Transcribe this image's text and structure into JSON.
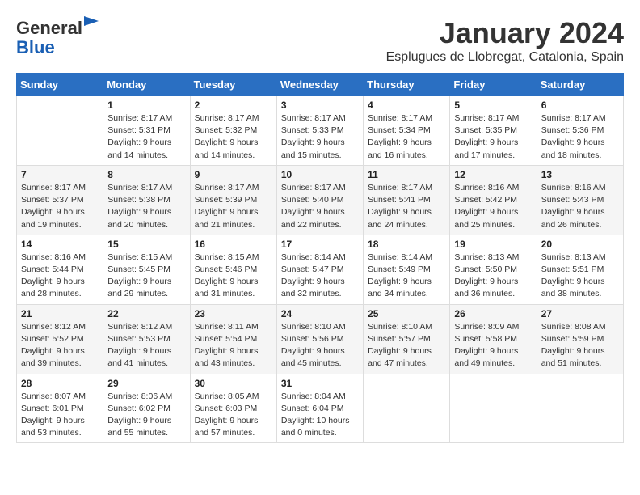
{
  "logo": {
    "general": "General",
    "blue": "Blue"
  },
  "title": "January 2024",
  "subtitle": "Esplugues de Llobregat, Catalonia, Spain",
  "weekdays": [
    "Sunday",
    "Monday",
    "Tuesday",
    "Wednesday",
    "Thursday",
    "Friday",
    "Saturday"
  ],
  "weeks": [
    [
      {
        "day": "",
        "sunrise": "",
        "sunset": "",
        "daylight": ""
      },
      {
        "day": "1",
        "sunrise": "Sunrise: 8:17 AM",
        "sunset": "Sunset: 5:31 PM",
        "daylight": "Daylight: 9 hours and 14 minutes."
      },
      {
        "day": "2",
        "sunrise": "Sunrise: 8:17 AM",
        "sunset": "Sunset: 5:32 PM",
        "daylight": "Daylight: 9 hours and 14 minutes."
      },
      {
        "day": "3",
        "sunrise": "Sunrise: 8:17 AM",
        "sunset": "Sunset: 5:33 PM",
        "daylight": "Daylight: 9 hours and 15 minutes."
      },
      {
        "day": "4",
        "sunrise": "Sunrise: 8:17 AM",
        "sunset": "Sunset: 5:34 PM",
        "daylight": "Daylight: 9 hours and 16 minutes."
      },
      {
        "day": "5",
        "sunrise": "Sunrise: 8:17 AM",
        "sunset": "Sunset: 5:35 PM",
        "daylight": "Daylight: 9 hours and 17 minutes."
      },
      {
        "day": "6",
        "sunrise": "Sunrise: 8:17 AM",
        "sunset": "Sunset: 5:36 PM",
        "daylight": "Daylight: 9 hours and 18 minutes."
      }
    ],
    [
      {
        "day": "7",
        "sunrise": "Sunrise: 8:17 AM",
        "sunset": "Sunset: 5:37 PM",
        "daylight": "Daylight: 9 hours and 19 minutes."
      },
      {
        "day": "8",
        "sunrise": "Sunrise: 8:17 AM",
        "sunset": "Sunset: 5:38 PM",
        "daylight": "Daylight: 9 hours and 20 minutes."
      },
      {
        "day": "9",
        "sunrise": "Sunrise: 8:17 AM",
        "sunset": "Sunset: 5:39 PM",
        "daylight": "Daylight: 9 hours and 21 minutes."
      },
      {
        "day": "10",
        "sunrise": "Sunrise: 8:17 AM",
        "sunset": "Sunset: 5:40 PM",
        "daylight": "Daylight: 9 hours and 22 minutes."
      },
      {
        "day": "11",
        "sunrise": "Sunrise: 8:17 AM",
        "sunset": "Sunset: 5:41 PM",
        "daylight": "Daylight: 9 hours and 24 minutes."
      },
      {
        "day": "12",
        "sunrise": "Sunrise: 8:16 AM",
        "sunset": "Sunset: 5:42 PM",
        "daylight": "Daylight: 9 hours and 25 minutes."
      },
      {
        "day": "13",
        "sunrise": "Sunrise: 8:16 AM",
        "sunset": "Sunset: 5:43 PM",
        "daylight": "Daylight: 9 hours and 26 minutes."
      }
    ],
    [
      {
        "day": "14",
        "sunrise": "Sunrise: 8:16 AM",
        "sunset": "Sunset: 5:44 PM",
        "daylight": "Daylight: 9 hours and 28 minutes."
      },
      {
        "day": "15",
        "sunrise": "Sunrise: 8:15 AM",
        "sunset": "Sunset: 5:45 PM",
        "daylight": "Daylight: 9 hours and 29 minutes."
      },
      {
        "day": "16",
        "sunrise": "Sunrise: 8:15 AM",
        "sunset": "Sunset: 5:46 PM",
        "daylight": "Daylight: 9 hours and 31 minutes."
      },
      {
        "day": "17",
        "sunrise": "Sunrise: 8:14 AM",
        "sunset": "Sunset: 5:47 PM",
        "daylight": "Daylight: 9 hours and 32 minutes."
      },
      {
        "day": "18",
        "sunrise": "Sunrise: 8:14 AM",
        "sunset": "Sunset: 5:49 PM",
        "daylight": "Daylight: 9 hours and 34 minutes."
      },
      {
        "day": "19",
        "sunrise": "Sunrise: 8:13 AM",
        "sunset": "Sunset: 5:50 PM",
        "daylight": "Daylight: 9 hours and 36 minutes."
      },
      {
        "day": "20",
        "sunrise": "Sunrise: 8:13 AM",
        "sunset": "Sunset: 5:51 PM",
        "daylight": "Daylight: 9 hours and 38 minutes."
      }
    ],
    [
      {
        "day": "21",
        "sunrise": "Sunrise: 8:12 AM",
        "sunset": "Sunset: 5:52 PM",
        "daylight": "Daylight: 9 hours and 39 minutes."
      },
      {
        "day": "22",
        "sunrise": "Sunrise: 8:12 AM",
        "sunset": "Sunset: 5:53 PM",
        "daylight": "Daylight: 9 hours and 41 minutes."
      },
      {
        "day": "23",
        "sunrise": "Sunrise: 8:11 AM",
        "sunset": "Sunset: 5:54 PM",
        "daylight": "Daylight: 9 hours and 43 minutes."
      },
      {
        "day": "24",
        "sunrise": "Sunrise: 8:10 AM",
        "sunset": "Sunset: 5:56 PM",
        "daylight": "Daylight: 9 hours and 45 minutes."
      },
      {
        "day": "25",
        "sunrise": "Sunrise: 8:10 AM",
        "sunset": "Sunset: 5:57 PM",
        "daylight": "Daylight: 9 hours and 47 minutes."
      },
      {
        "day": "26",
        "sunrise": "Sunrise: 8:09 AM",
        "sunset": "Sunset: 5:58 PM",
        "daylight": "Daylight: 9 hours and 49 minutes."
      },
      {
        "day": "27",
        "sunrise": "Sunrise: 8:08 AM",
        "sunset": "Sunset: 5:59 PM",
        "daylight": "Daylight: 9 hours and 51 minutes."
      }
    ],
    [
      {
        "day": "28",
        "sunrise": "Sunrise: 8:07 AM",
        "sunset": "Sunset: 6:01 PM",
        "daylight": "Daylight: 9 hours and 53 minutes."
      },
      {
        "day": "29",
        "sunrise": "Sunrise: 8:06 AM",
        "sunset": "Sunset: 6:02 PM",
        "daylight": "Daylight: 9 hours and 55 minutes."
      },
      {
        "day": "30",
        "sunrise": "Sunrise: 8:05 AM",
        "sunset": "Sunset: 6:03 PM",
        "daylight": "Daylight: 9 hours and 57 minutes."
      },
      {
        "day": "31",
        "sunrise": "Sunrise: 8:04 AM",
        "sunset": "Sunset: 6:04 PM",
        "daylight": "Daylight: 10 hours and 0 minutes."
      },
      {
        "day": "",
        "sunrise": "",
        "sunset": "",
        "daylight": ""
      },
      {
        "day": "",
        "sunrise": "",
        "sunset": "",
        "daylight": ""
      },
      {
        "day": "",
        "sunrise": "",
        "sunset": "",
        "daylight": ""
      }
    ]
  ]
}
